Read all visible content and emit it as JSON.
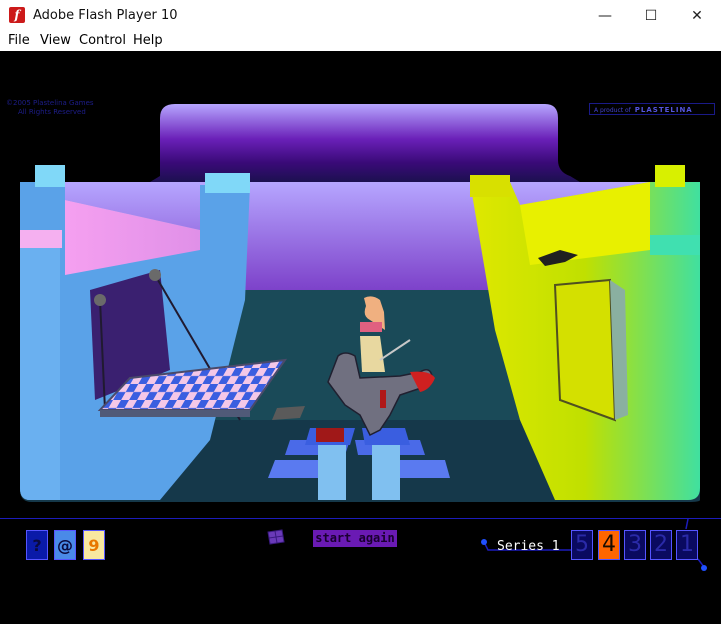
{
  "window": {
    "title": "Adobe Flash Player 10",
    "minimize": "—",
    "maximize": "☐",
    "close": "✕"
  },
  "menu": [
    "File",
    "View",
    "Control",
    "Help"
  ],
  "game": {
    "copyright_line1": "©2005 Plastelina Games",
    "copyright_line2": "All Rights Reserved",
    "product_prefix": "A product of",
    "product_brand": "PLASTELINA"
  },
  "hud": {
    "help_label": "?",
    "at_label": "@",
    "sound_label": "9",
    "start_again": "start again",
    "series_label": "Series 1",
    "levels": [
      "5",
      "4",
      "3",
      "2",
      "1"
    ],
    "active_level": "4"
  },
  "colors": {
    "accent": "#ff6600",
    "hud_border": "#1c1cbb",
    "start_button": "#6a1ab4"
  }
}
